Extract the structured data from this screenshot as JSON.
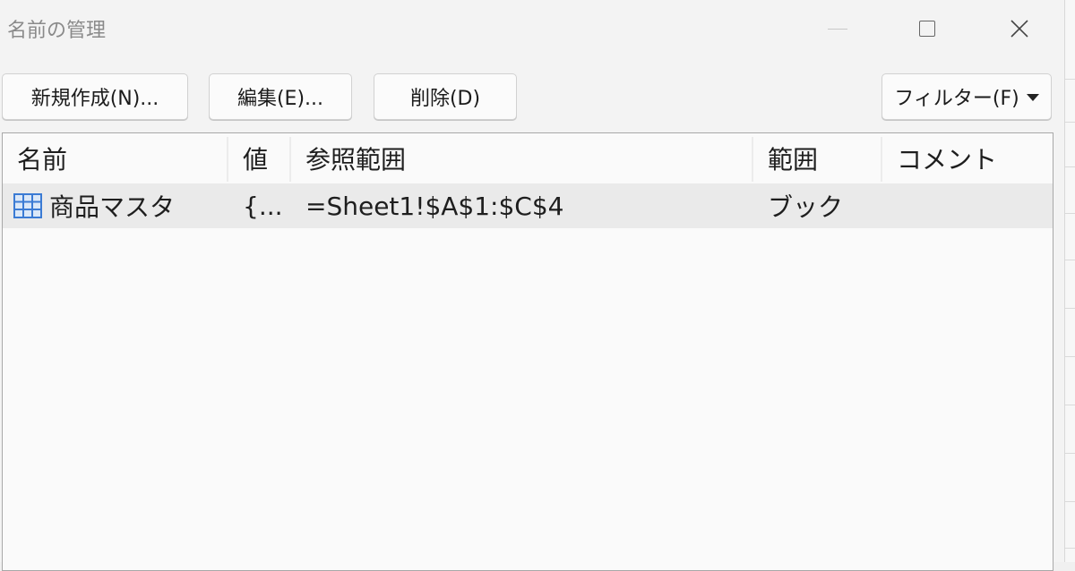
{
  "window": {
    "title": "名前の管理"
  },
  "toolbar": {
    "new_label": "新規作成(N)...",
    "edit_label": "編集(E)...",
    "delete_label": "削除(D)",
    "filter_label": "フィルター(F)"
  },
  "list": {
    "columns": [
      "名前",
      "値",
      "参照範囲",
      "範囲",
      "コメント"
    ],
    "rows": [
      {
        "icon": "table-icon",
        "name": "商品マスタ",
        "value": "{...",
        "refers_to": "=Sheet1!$A$1:$C$4",
        "scope": "ブック",
        "comment": ""
      }
    ]
  },
  "colors": {
    "selected_row": "#eaeaea",
    "icon_blue": "#3b7bd4"
  }
}
